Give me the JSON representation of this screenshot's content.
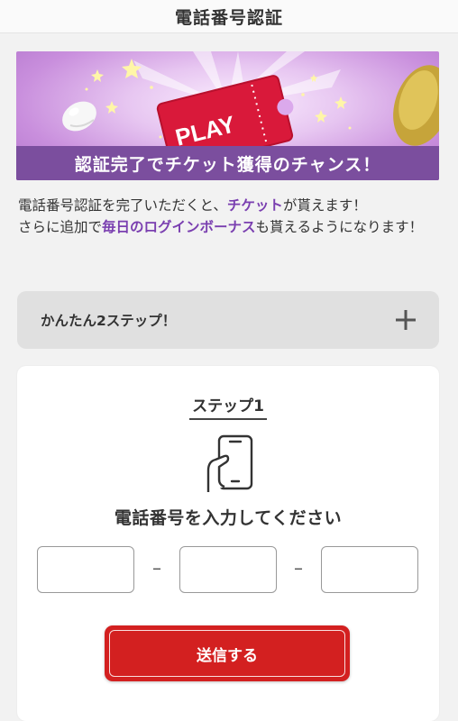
{
  "header": {
    "title": "電話番号認証"
  },
  "banner": {
    "ticket_text": "PLAY",
    "caption": "認証完了でチケット獲得のチャンス！"
  },
  "intro": {
    "line1_a": "電話番号認証を完了いただくと、",
    "line1_hl": "チケット",
    "line1_b": "が貰えます！",
    "line2_a": "さらに追加で",
    "line2_hl": "毎日のログインボーナス",
    "line2_b": "も貰えるようになります！"
  },
  "accordion": {
    "label": "かんたん2ステップ！",
    "icon": "plus-icon"
  },
  "step": {
    "title": "ステップ1",
    "icon": "phone-in-hand-icon",
    "prompt": "電話番号を入力してください",
    "fields": [
      "",
      "",
      ""
    ],
    "separator": "–",
    "submit_label": "送信する"
  },
  "colors": {
    "accent_purple": "#7a3fb0",
    "banner_strip": "#7b4e9e",
    "submit_red": "#d32020",
    "ticket_red": "#d9193a"
  }
}
